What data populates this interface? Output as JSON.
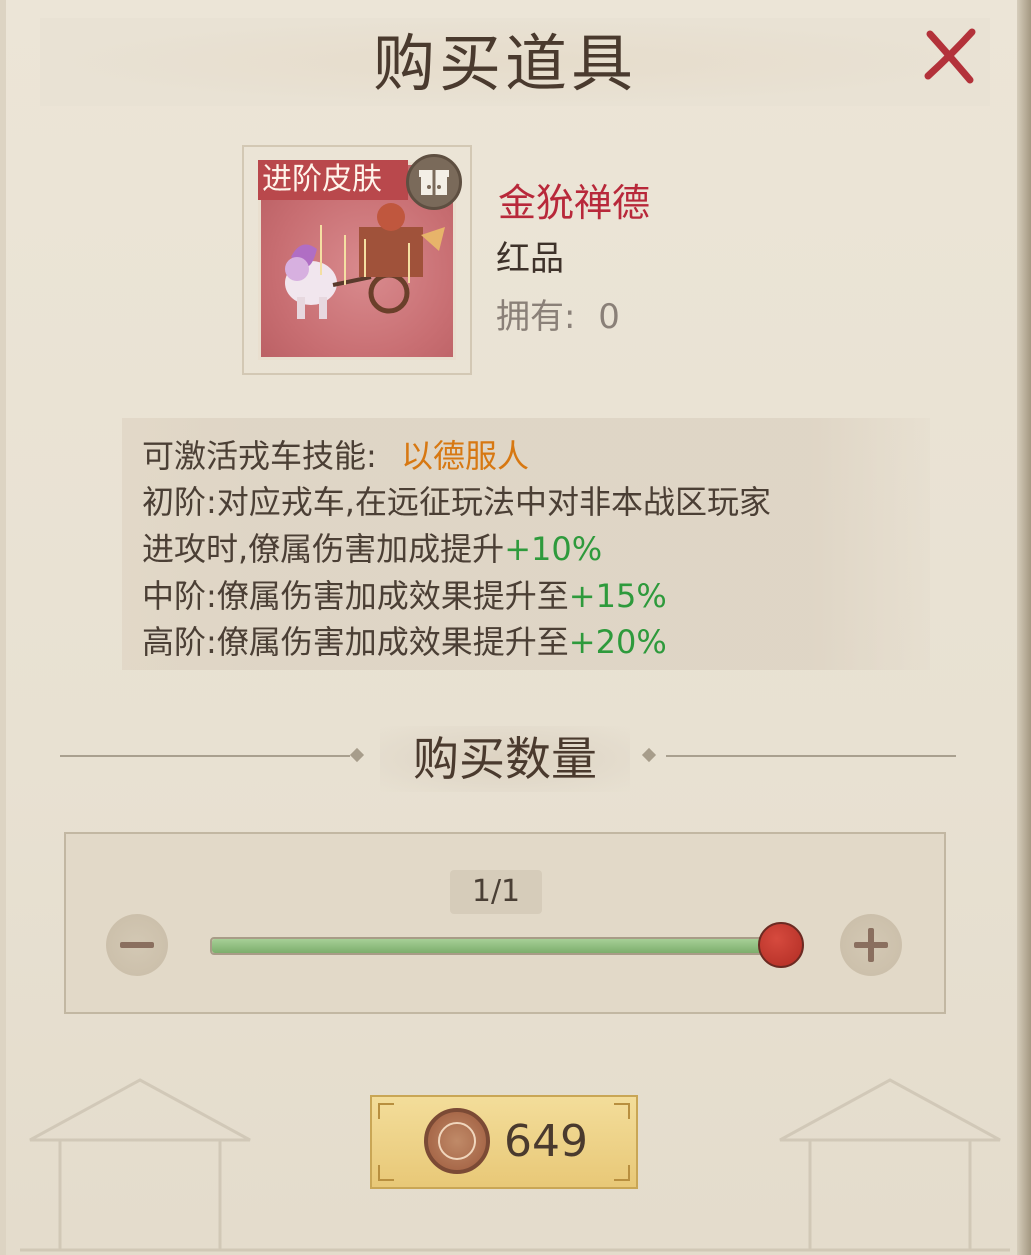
{
  "dialog": {
    "title": "购买道具",
    "close_icon": "close-icon"
  },
  "item": {
    "tag": "进阶皮肤",
    "name": "金狁禅德",
    "rarity": "红品",
    "owned_label": "拥有:",
    "owned_value": "0",
    "badge_icon": "gift-icon",
    "image_icon": "chariot-image"
  },
  "description": {
    "skill_label": "可激活戎车技能:",
    "skill_name": "以德服人",
    "line2": "初阶:对应戎车,在远征玩法中对非本战区玩家",
    "line3_text": "进攻时,僚属伤害加成提升",
    "line3_value": "+10%",
    "line4_text": "中阶:僚属伤害加成效果提升至",
    "line4_value": "+15%",
    "line5_text": "高阶:僚属伤害加成效果提升至",
    "line5_value": "+20%"
  },
  "quantity": {
    "label": "购买数量",
    "count_text": "1/1",
    "current": 1,
    "max": 1,
    "minus_icon": "minus-icon",
    "plus_icon": "plus-icon"
  },
  "purchase": {
    "price": "649",
    "currency_icon": "coin-icon"
  },
  "colors": {
    "item_name": "#b8283a",
    "skill_name": "#d77812",
    "bonus": "#2e9a3c",
    "slider_fill": "#7dae6c",
    "knob": "#b12d24",
    "price_button": "#f3dd9a"
  }
}
